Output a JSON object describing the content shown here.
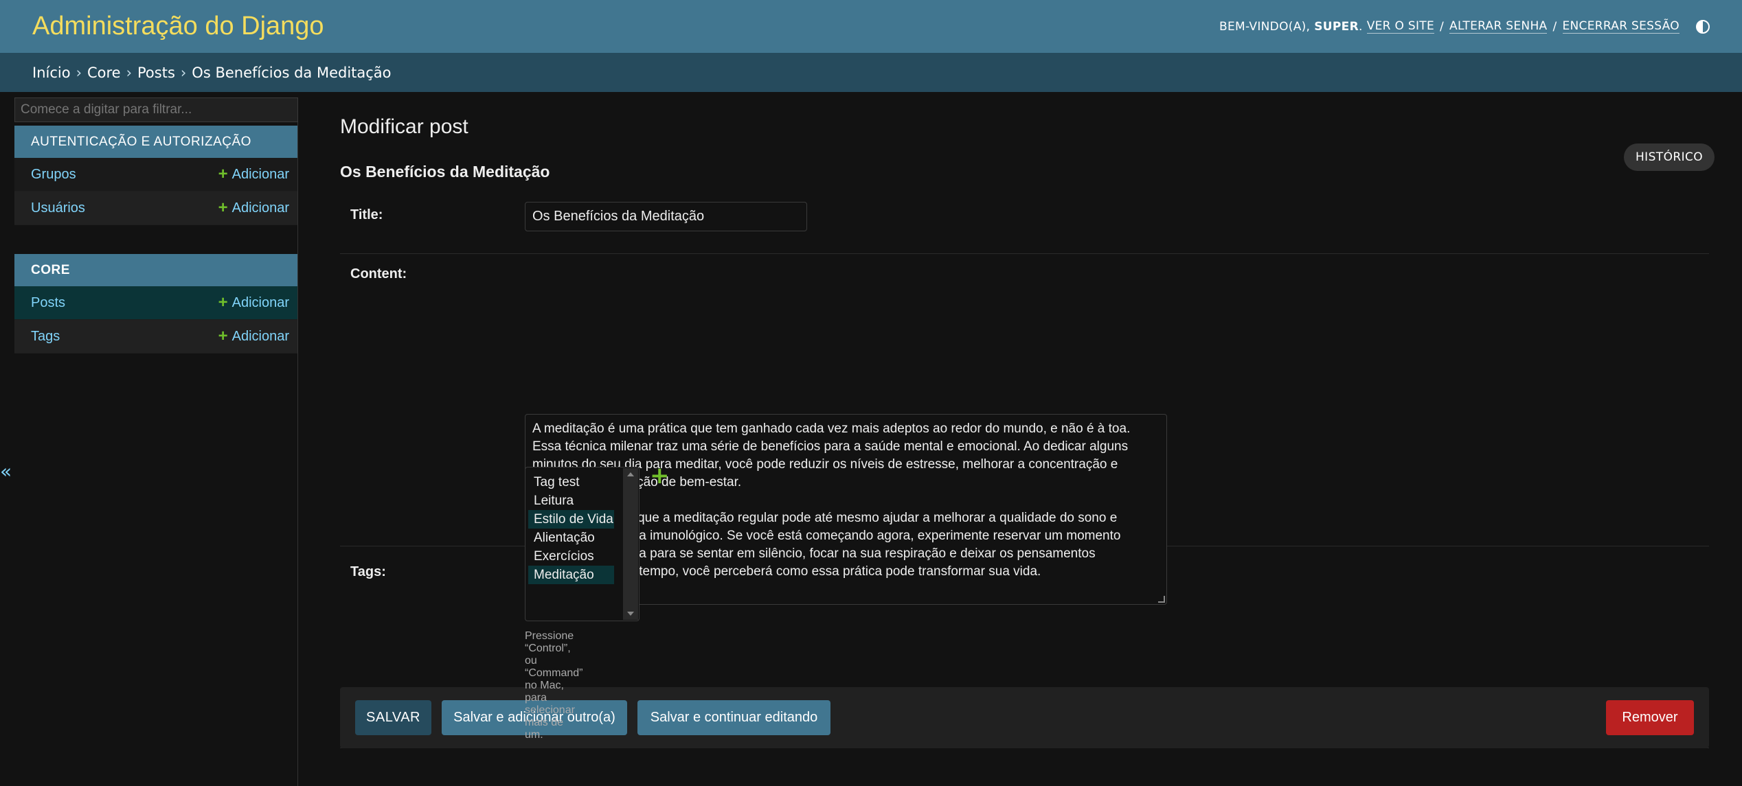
{
  "header": {
    "branding": "Administração do Django",
    "welcome": "BEM-VINDO(A),",
    "username": "SUPER",
    "view_site": "VER O SITE",
    "change_password": "ALTERAR SENHA",
    "logout": "ENCERRAR SESSÃO",
    "separator": "/"
  },
  "breadcrumbs": {
    "items": [
      "Início",
      "Core",
      "Posts"
    ],
    "current": "Os Benefícios da Meditação",
    "arrow": "›"
  },
  "sidebar": {
    "filter_placeholder": "Comece a digitar para filtrar...",
    "apps": [
      {
        "caption": "AUTENTICAÇÃO E AUTORIZAÇÃO",
        "models": [
          {
            "name": "Grupos",
            "add": "Adicionar"
          },
          {
            "name": "Usuários",
            "add": "Adicionar"
          }
        ]
      },
      {
        "caption": "CORE",
        "models": [
          {
            "name": "Posts",
            "add": "Adicionar"
          },
          {
            "name": "Tags",
            "add": "Adicionar"
          }
        ]
      }
    ],
    "toggle": "«"
  },
  "main": {
    "page_title": "Modificar post",
    "history_button": "HISTÓRICO",
    "object_title": "Os Benefícios da Meditação",
    "fields": {
      "title_label": "Title:",
      "title_value": "Os Benefícios da Meditação",
      "content_label": "Content:",
      "content_paragraph_1": "A meditação é uma prática que tem ganhado cada vez mais adeptos ao redor do mundo, e não é à toa.\nEssa técnica milenar traz uma série de benefícios para a saúde mental e emocional. Ao dedicar alguns\nminutos do seu dia para meditar, você pode reduzir os níveis de estresse, melhorar a concentração e\naumentar a sensação de bem-estar.",
      "content_paragraph_2": "Estudos mostram que a meditação regular pode até mesmo ajudar a melhorar a qualidade do sono e\nfortalecer o sistema imunológico. Se você está começando agora, experimente reservar um momento\ntranquilo do seu dia para se sentar em silêncio, focar na sua respiração e deixar os pensamentos\npassarem. Com o tempo, você perceberá como essa prática pode transformar sua vida.",
      "tags_label": "Tags:",
      "tags_options": [
        {
          "label": "Tag test",
          "selected": false
        },
        {
          "label": "Leitura",
          "selected": false
        },
        {
          "label": "Estilo de Vida",
          "selected": true
        },
        {
          "label": "Alientação",
          "selected": false
        },
        {
          "label": "Exercícios",
          "selected": false
        },
        {
          "label": "Meditação",
          "selected": true
        }
      ],
      "tags_add": "+",
      "tags_help": "Pressione “Control”, ou “Command” no Mac, para selecionar mais de um."
    },
    "buttons": {
      "save": "SALVAR",
      "save_add_another": "Salvar e adicionar outro(a)",
      "save_continue": "Salvar e continuar editando",
      "delete": "Remover"
    }
  },
  "colors": {
    "header_bg": "#417690",
    "branding": "#f5dd5d",
    "breadcrumbs_bg": "#264b5d",
    "link": "#81d4fa",
    "add_green": "#70bf2b",
    "delete_red": "#ba2121",
    "selected_row": "#0b3437"
  }
}
